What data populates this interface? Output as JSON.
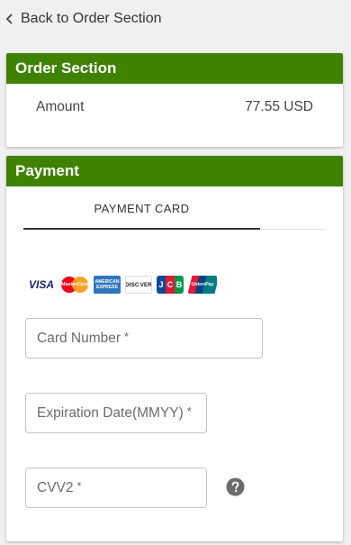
{
  "nav": {
    "back_label": "Back to Order Section"
  },
  "order_section": {
    "title": "Order Section",
    "amount_label": "Amount",
    "amount_value": "77.55 USD"
  },
  "payment": {
    "title": "Payment",
    "tabs": [
      {
        "label": "PAYMENT CARD",
        "active": true
      }
    ],
    "accepted_cards": [
      "VISA",
      "MasterCard",
      "American Express",
      "DISCOVER",
      "JCB",
      "UnionPay"
    ],
    "fields": {
      "card_number": {
        "placeholder": "Card Number",
        "required_mark": "*"
      },
      "expiration": {
        "placeholder": "Expiration Date(MMYY)",
        "required_mark": "*"
      },
      "cvv2": {
        "placeholder": "CVV2",
        "required_mark": "*"
      }
    }
  },
  "colors": {
    "header_green": "#3e8200",
    "background": "#f0f0f0",
    "help_icon": "#6b6b6b"
  },
  "icons": {
    "back": "chevron-left-icon",
    "help": "question-circle-icon"
  }
}
